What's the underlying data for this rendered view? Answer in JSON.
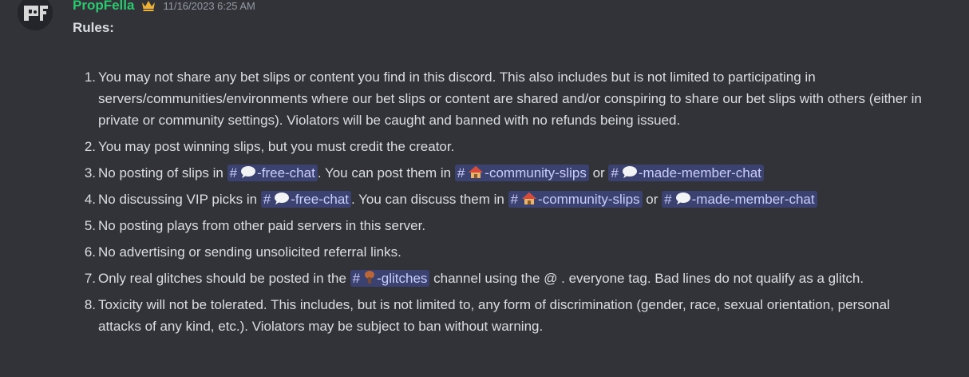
{
  "message": {
    "author": "PropFella",
    "timestamp": "11/16/2023 6:25 AM",
    "title": "Rules:",
    "colors": {
      "background": "#313338",
      "username": "#2dc770",
      "crown": "#f0b232",
      "mention_bg": "#3c4270",
      "mention_text": "#c9cdfb",
      "text": "#dbdee1",
      "muted": "#949ba4"
    },
    "icons": {
      "crown": "crown-icon",
      "speech": "speech-bubble-icon",
      "house": "house-icon",
      "glitch": "mushroom-icon"
    },
    "channels": {
      "free_chat": "-free-chat",
      "community_slips": "-community-slips",
      "made_member_chat": "-made-member-chat",
      "glitches": "-glitches",
      "hash": "#"
    },
    "rules": [
      {
        "num": "1.",
        "text": "You may not share any bet slips or content you find in this discord. This also includes but is not limited to participating in servers/communities/environments where our bet slips or content are shared and/or conspiring to share our bet slips with others (either in private or community settings). Violators will be caught and banned with no refunds being issued."
      },
      {
        "num": "2.",
        "text": "You may post winning slips, but you must credit the creator."
      },
      {
        "num": "3.",
        "pre": "No posting of slips in ",
        "mid": ". You can post them in ",
        "or": "or"
      },
      {
        "num": "4.",
        "pre": "No discussing VIP picks in ",
        "mid": ". You can discuss them in ",
        "or": "or"
      },
      {
        "num": "5.",
        "text": "No posting plays from other paid servers in this server."
      },
      {
        "num": "6.",
        "text": "No advertising or sending unsolicited referral links."
      },
      {
        "num": "7.",
        "pre": "Only real glitches should be posted in the ",
        "post": " channel using the @ . everyone tag. Bad lines do not qualify as a glitch."
      },
      {
        "num": "8.",
        "text": "Toxicity will not be tolerated. This includes, but is not limited to, any form of discrimination (gender, race, sexual orientation, personal attacks of any kind, etc.). Violators may be subject to ban without warning."
      }
    ]
  }
}
